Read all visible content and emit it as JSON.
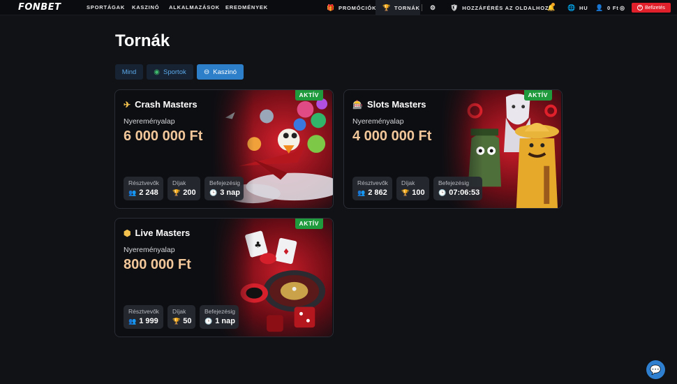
{
  "header": {
    "logo": "FONBET",
    "nav": [
      "SPORTÁGAK",
      "KASZINÓ",
      "ALKALMAZÁSOK",
      "EREDMÉNYEK"
    ],
    "promotions": "PROMÓCIÓK",
    "tournaments": "TORNÁK",
    "access": "HOZZÁFÉRÉS AZ OLDALHOZ",
    "language": "HU",
    "balance": "0 Ft",
    "deposit": "Befizetés"
  },
  "page": {
    "title": "Tornák",
    "filters": [
      "Mind",
      "Sportok",
      "Kaszinó"
    ],
    "active_filter": "Kaszinó"
  },
  "labels": {
    "status": "AKTÍV",
    "prize_pool": "Nyereményalap",
    "participants": "Résztvevők",
    "prizes": "Díjak",
    "ends": "Befejezésig"
  },
  "tournaments": [
    {
      "name": "Crash Masters",
      "prize_pool": "6 000 000 Ft",
      "participants": "2 248",
      "prizes": "200",
      "ends": "3 nap"
    },
    {
      "name": "Slots Masters",
      "prize_pool": "4 000 000 Ft",
      "participants": "2 862",
      "prizes": "100",
      "ends": "07:06:53"
    },
    {
      "name": "Live Masters",
      "prize_pool": "800 000 Ft",
      "participants": "1 999",
      "prizes": "50",
      "ends": "1 nap"
    }
  ],
  "colors": {
    "accent": "#2d7fc9",
    "active_badge": "#1f9a3c",
    "prize_amount": "#f2c79a",
    "deposit": "#e0212b"
  }
}
